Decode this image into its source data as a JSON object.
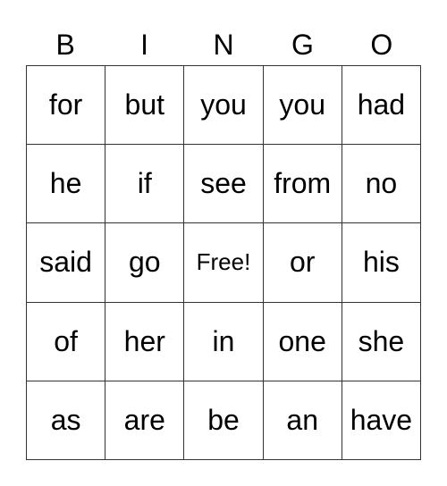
{
  "header": [
    "B",
    "I",
    "N",
    "G",
    "O"
  ],
  "cells": [
    [
      "for",
      "but",
      "you",
      "you",
      "had"
    ],
    [
      "he",
      "if",
      "see",
      "from",
      "no"
    ],
    [
      "said",
      "go",
      "Free!",
      "or",
      "his"
    ],
    [
      "of",
      "her",
      "in",
      "one",
      "she"
    ],
    [
      "as",
      "are",
      "be",
      "an",
      "have"
    ]
  ]
}
